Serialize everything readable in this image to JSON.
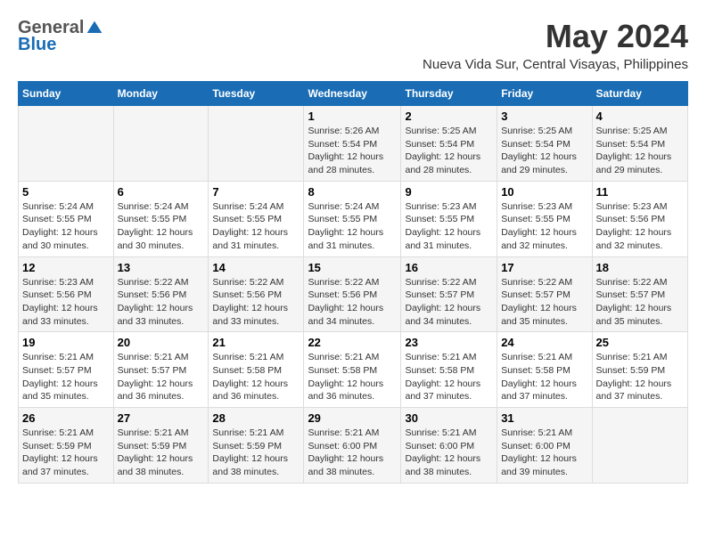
{
  "header": {
    "logo": {
      "general": "General",
      "blue": "Blue",
      "tagline": ""
    },
    "title": "May 2024",
    "location": "Nueva Vida Sur, Central Visayas, Philippines"
  },
  "weekdays": [
    "Sunday",
    "Monday",
    "Tuesday",
    "Wednesday",
    "Thursday",
    "Friday",
    "Saturday"
  ],
  "weeks": [
    [
      null,
      null,
      null,
      {
        "day": "1",
        "sunrise": "5:26 AM",
        "sunset": "5:54 PM",
        "daylight": "12 hours and 28 minutes."
      },
      {
        "day": "2",
        "sunrise": "5:25 AM",
        "sunset": "5:54 PM",
        "daylight": "12 hours and 28 minutes."
      },
      {
        "day": "3",
        "sunrise": "5:25 AM",
        "sunset": "5:54 PM",
        "daylight": "12 hours and 29 minutes."
      },
      {
        "day": "4",
        "sunrise": "5:25 AM",
        "sunset": "5:54 PM",
        "daylight": "12 hours and 29 minutes."
      }
    ],
    [
      {
        "day": "5",
        "sunrise": "5:24 AM",
        "sunset": "5:55 PM",
        "daylight": "12 hours and 30 minutes."
      },
      {
        "day": "6",
        "sunrise": "5:24 AM",
        "sunset": "5:55 PM",
        "daylight": "12 hours and 30 minutes."
      },
      {
        "day": "7",
        "sunrise": "5:24 AM",
        "sunset": "5:55 PM",
        "daylight": "12 hours and 31 minutes."
      },
      {
        "day": "8",
        "sunrise": "5:24 AM",
        "sunset": "5:55 PM",
        "daylight": "12 hours and 31 minutes."
      },
      {
        "day": "9",
        "sunrise": "5:23 AM",
        "sunset": "5:55 PM",
        "daylight": "12 hours and 31 minutes."
      },
      {
        "day": "10",
        "sunrise": "5:23 AM",
        "sunset": "5:55 PM",
        "daylight": "12 hours and 32 minutes."
      },
      {
        "day": "11",
        "sunrise": "5:23 AM",
        "sunset": "5:56 PM",
        "daylight": "12 hours and 32 minutes."
      }
    ],
    [
      {
        "day": "12",
        "sunrise": "5:23 AM",
        "sunset": "5:56 PM",
        "daylight": "12 hours and 33 minutes."
      },
      {
        "day": "13",
        "sunrise": "5:22 AM",
        "sunset": "5:56 PM",
        "daylight": "12 hours and 33 minutes."
      },
      {
        "day": "14",
        "sunrise": "5:22 AM",
        "sunset": "5:56 PM",
        "daylight": "12 hours and 33 minutes."
      },
      {
        "day": "15",
        "sunrise": "5:22 AM",
        "sunset": "5:56 PM",
        "daylight": "12 hours and 34 minutes."
      },
      {
        "day": "16",
        "sunrise": "5:22 AM",
        "sunset": "5:57 PM",
        "daylight": "12 hours and 34 minutes."
      },
      {
        "day": "17",
        "sunrise": "5:22 AM",
        "sunset": "5:57 PM",
        "daylight": "12 hours and 35 minutes."
      },
      {
        "day": "18",
        "sunrise": "5:22 AM",
        "sunset": "5:57 PM",
        "daylight": "12 hours and 35 minutes."
      }
    ],
    [
      {
        "day": "19",
        "sunrise": "5:21 AM",
        "sunset": "5:57 PM",
        "daylight": "12 hours and 35 minutes."
      },
      {
        "day": "20",
        "sunrise": "5:21 AM",
        "sunset": "5:57 PM",
        "daylight": "12 hours and 36 minutes."
      },
      {
        "day": "21",
        "sunrise": "5:21 AM",
        "sunset": "5:58 PM",
        "daylight": "12 hours and 36 minutes."
      },
      {
        "day": "22",
        "sunrise": "5:21 AM",
        "sunset": "5:58 PM",
        "daylight": "12 hours and 36 minutes."
      },
      {
        "day": "23",
        "sunrise": "5:21 AM",
        "sunset": "5:58 PM",
        "daylight": "12 hours and 37 minutes."
      },
      {
        "day": "24",
        "sunrise": "5:21 AM",
        "sunset": "5:58 PM",
        "daylight": "12 hours and 37 minutes."
      },
      {
        "day": "25",
        "sunrise": "5:21 AM",
        "sunset": "5:59 PM",
        "daylight": "12 hours and 37 minutes."
      }
    ],
    [
      {
        "day": "26",
        "sunrise": "5:21 AM",
        "sunset": "5:59 PM",
        "daylight": "12 hours and 37 minutes."
      },
      {
        "day": "27",
        "sunrise": "5:21 AM",
        "sunset": "5:59 PM",
        "daylight": "12 hours and 38 minutes."
      },
      {
        "day": "28",
        "sunrise": "5:21 AM",
        "sunset": "5:59 PM",
        "daylight": "12 hours and 38 minutes."
      },
      {
        "day": "29",
        "sunrise": "5:21 AM",
        "sunset": "6:00 PM",
        "daylight": "12 hours and 38 minutes."
      },
      {
        "day": "30",
        "sunrise": "5:21 AM",
        "sunset": "6:00 PM",
        "daylight": "12 hours and 38 minutes."
      },
      {
        "day": "31",
        "sunrise": "5:21 AM",
        "sunset": "6:00 PM",
        "daylight": "12 hours and 39 minutes."
      },
      null
    ]
  ]
}
